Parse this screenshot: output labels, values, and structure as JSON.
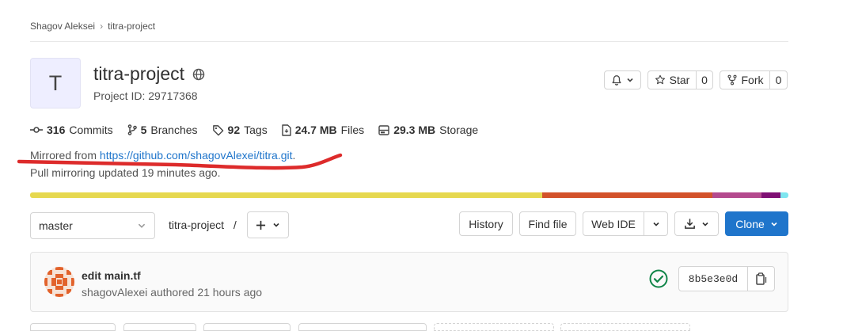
{
  "breadcrumb": {
    "owner": "Shagov Aleksei",
    "separator": "›",
    "project": "titra-project"
  },
  "project": {
    "avatar_letter": "T",
    "name": "titra-project",
    "id_text": "Project ID: 29717368",
    "visibility_icon": "globe-icon"
  },
  "header_actions": {
    "notification_icon": "bell-icon",
    "star_label": "Star",
    "star_count": "0",
    "fork_label": "Fork",
    "fork_count": "0"
  },
  "stats": [
    {
      "icon": "commit-icon",
      "count": "316",
      "label": "Commits"
    },
    {
      "icon": "branch-icon",
      "count": "5",
      "label": "Branches"
    },
    {
      "icon": "tag-icon",
      "count": "92",
      "label": "Tags"
    },
    {
      "icon": "file-icon",
      "count": "24.7 MB",
      "label": "Files"
    },
    {
      "icon": "storage-icon",
      "count": "29.3 MB",
      "label": "Storage"
    }
  ],
  "mirror": {
    "prefix": "Mirrored from ",
    "url": "https://github.com/shagovAlexei/titra.git",
    "suffix": ".",
    "pull_status": "Pull mirroring updated 19 minutes ago."
  },
  "language_bar": [
    {
      "share": 67.5,
      "color": "#e6d84f"
    },
    {
      "share": 22.5,
      "color": "#d3522a"
    },
    {
      "share": 6.5,
      "color": "#b44a8e"
    },
    {
      "share": 2.5,
      "color": "#7f1074"
    },
    {
      "share": 1.0,
      "color": "#7ee6f0"
    }
  ],
  "toolbar": {
    "branch_selected": "master",
    "path_root": "titra-project",
    "path_sep": "/",
    "add_icon": "plus-icon",
    "history_label": "History",
    "find_file_label": "Find file",
    "web_ide_label": "Web IDE",
    "download_icon": "download-icon",
    "clone_label": "Clone"
  },
  "last_commit": {
    "title": "edit main.tf",
    "author": "shagovAlexei",
    "authored_text": " authored 21 hours ago",
    "status_icon": "check-circle-icon",
    "sha": "8b5e3e0d",
    "copy_icon": "copy-icon"
  },
  "colors": {
    "link": "#1f75cb",
    "clone_button": "#1f75cb",
    "success": "#108548",
    "annotation": "#dd2b2b"
  }
}
